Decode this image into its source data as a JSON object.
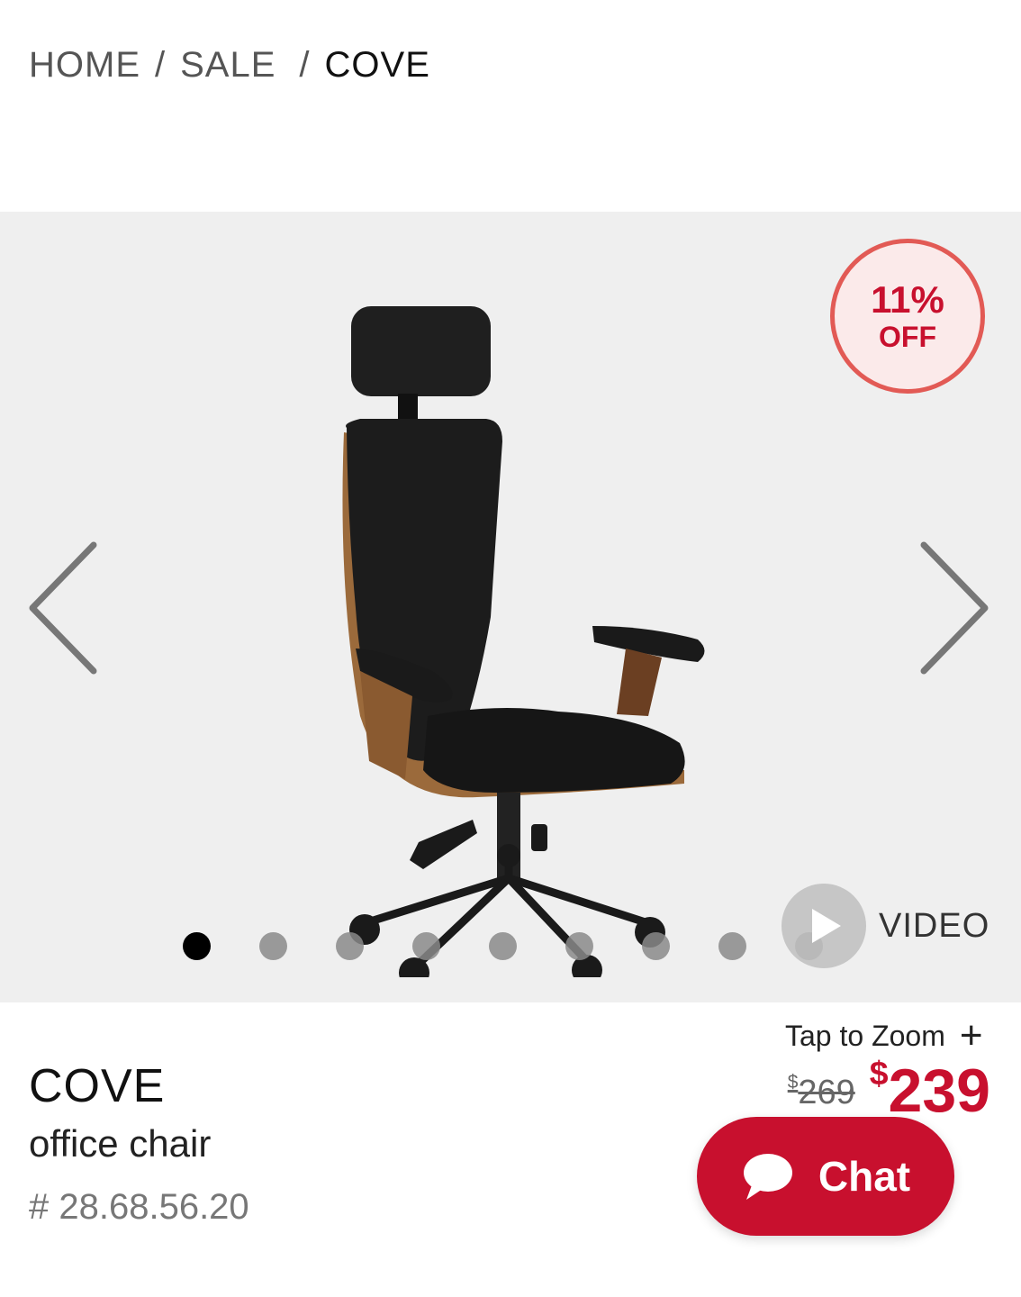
{
  "breadcrumb": {
    "home": "HOME",
    "separator": "/",
    "sale": "SALE",
    "current": "COVE"
  },
  "gallery": {
    "discount": {
      "percent": "11%",
      "label": "OFF"
    },
    "image_alt": "COVE office chair",
    "dot_count": 9,
    "active_dot": 0,
    "video_label": "VIDEO",
    "prev_icon": "chevron-left-icon",
    "next_icon": "chevron-right-icon"
  },
  "zoom": {
    "label": "Tap to Zoom",
    "plus": "+"
  },
  "product": {
    "name": "COVE",
    "type": "office chair",
    "sku": "# 28.68.56.20"
  },
  "price": {
    "currency": "$",
    "original": "269",
    "sale": "239"
  },
  "chat": {
    "label": "Chat"
  },
  "colors": {
    "accent_red": "#c8102e",
    "badge_border": "#e25a55",
    "badge_bg": "#fbeaea",
    "gallery_bg": "#efefef"
  }
}
